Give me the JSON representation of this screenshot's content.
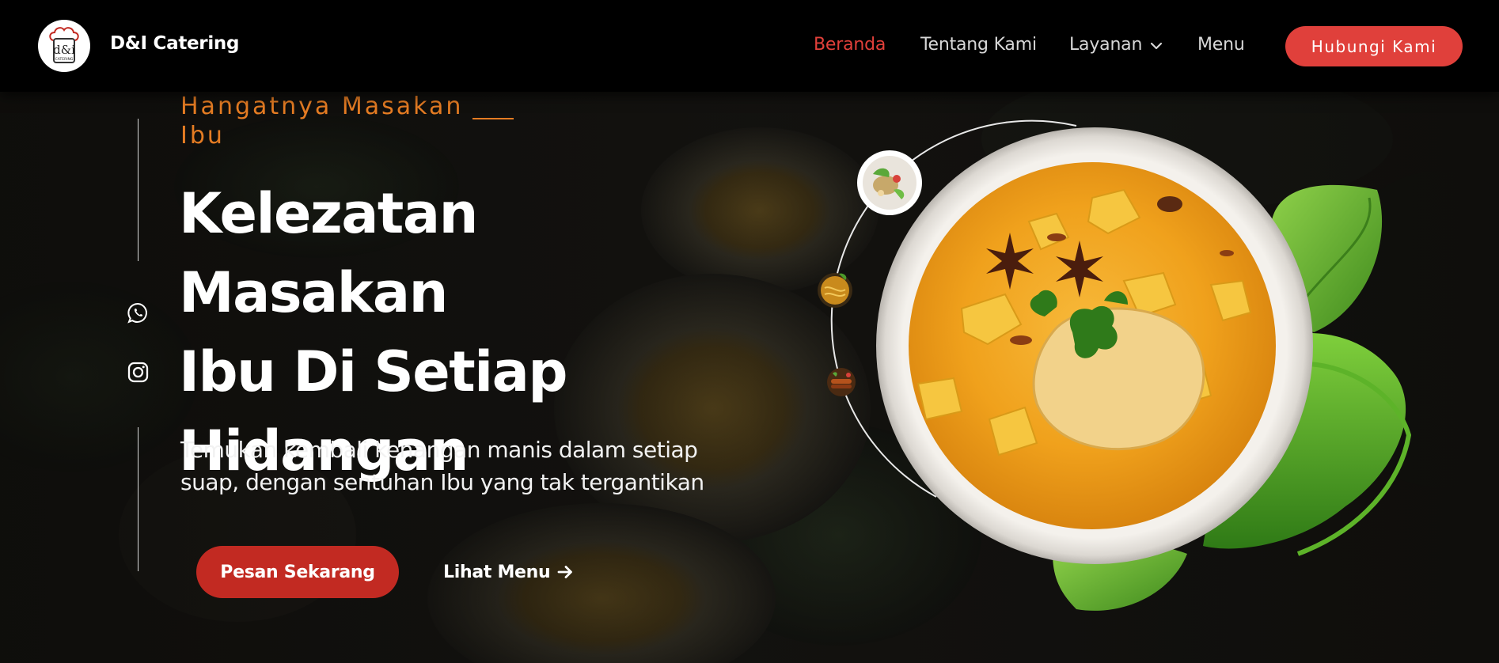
{
  "brand": {
    "name": "D&I Catering",
    "logo_text": "d&i",
    "logo_subtext": "CATERING",
    "logo_icon": "chef-hat-logo"
  },
  "nav": {
    "items": [
      {
        "label": "Beranda",
        "active": true
      },
      {
        "label": "Tentang Kami",
        "active": false
      },
      {
        "label": "Layanan",
        "active": false,
        "has_dropdown": true
      },
      {
        "label": "Menu",
        "active": false
      }
    ],
    "cta_label": "Hubungi Kami"
  },
  "hero": {
    "eyebrow": "Hangatnya Masakan Ibu",
    "headline_lines": [
      "Kelezatan Masakan",
      "Ibu Di Setiap",
      "Hidangan"
    ],
    "subtitle_lines": [
      "Temukan kembali kenangan manis dalam setiap",
      "suap, dengan sentuhan Ibu yang tak tergantikan"
    ],
    "primary_button": "Pesan Sekarang",
    "secondary_button": "Lihat Menu",
    "secondary_icon": "arrow-right-icon",
    "social_icons": [
      "whatsapp-icon",
      "instagram-icon"
    ],
    "thumbnails": [
      "salad-dish-thumb",
      "noodle-dish-thumb",
      "satay-dish-thumb"
    ],
    "main_image": "curry-chicken-bowl"
  },
  "colors": {
    "accent_red": "#e0403b",
    "button_red": "#c22a22",
    "eyebrow_orange": "#e57c23",
    "navbar_bg": "#000000",
    "curry_yellow": "#f2a71c"
  }
}
